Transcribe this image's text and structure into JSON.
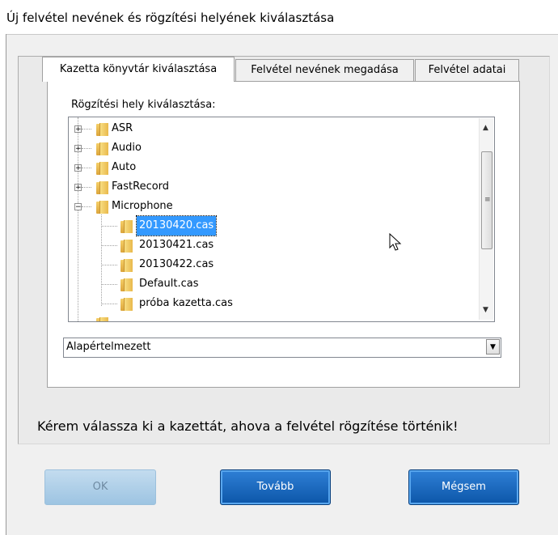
{
  "window": {
    "title": "Új felvétel nevének és rögzítési helyének kiválasztása"
  },
  "tabs": [
    {
      "label": "Kazetta könyvtár kiválasztása",
      "active": true
    },
    {
      "label": "Felvétel nevének megadása",
      "active": false
    },
    {
      "label": "Felvétel adatai",
      "active": false
    }
  ],
  "group": {
    "label": "Rögzítési hely kiválasztása:"
  },
  "tree": {
    "items": [
      {
        "label": "ASR",
        "expander": "+"
      },
      {
        "label": "Audio",
        "expander": "+"
      },
      {
        "label": "Auto",
        "expander": "+"
      },
      {
        "label": "FastRecord",
        "expander": "+"
      },
      {
        "label": "Microphone",
        "expander": "−"
      }
    ],
    "children": [
      {
        "label": "20130420.cas",
        "selected": true
      },
      {
        "label": "20130421.cas",
        "selected": false
      },
      {
        "label": "20130422.cas",
        "selected": false
      },
      {
        "label": "Default.cas",
        "selected": false
      },
      {
        "label": "próba kazetta.cas",
        "selected": false
      }
    ]
  },
  "scrollbar": {
    "up_arrow": "▲",
    "down_arrow": "▼",
    "grip": "≡"
  },
  "combo": {
    "value": "Alapértelmezett",
    "arrow": "▼"
  },
  "status_text": "Kérem válassza ki a kazettát, ahova  a felvétel rögzítése történik!",
  "buttons": {
    "ok": "OK",
    "next": "Tovább",
    "cancel": "Mégsem"
  },
  "colors": {
    "selection": "#3399ff",
    "button_blue": "#0c56a8",
    "button_disabled": "#b0d0ea"
  },
  "icons": {
    "folder": "folder-icon",
    "cursor": "mouse-pointer-icon"
  }
}
